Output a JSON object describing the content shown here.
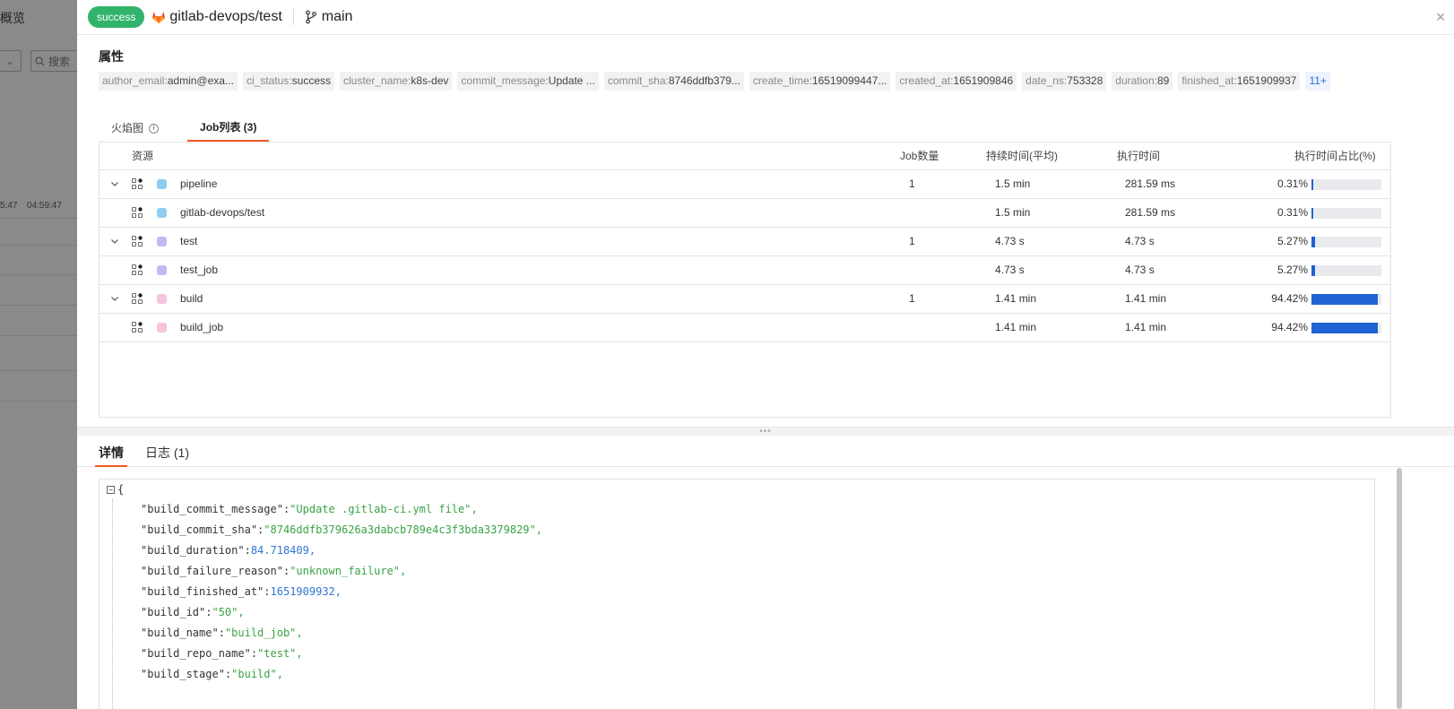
{
  "background": {
    "title": "概览",
    "search_placeholder": "搜索",
    "times": [
      "5:47",
      "04:59:47"
    ]
  },
  "header": {
    "status": "success",
    "repo": "gitlab-devops/test",
    "branch": "main",
    "close_label": "×"
  },
  "properties": {
    "title": "属性",
    "tags": [
      {
        "k": "author_email:",
        "v": "admin@exa..."
      },
      {
        "k": "ci_status:",
        "v": "success"
      },
      {
        "k": "cluster_name:",
        "v": "k8s-dev"
      },
      {
        "k": "commit_message:",
        "v": "Update ..."
      },
      {
        "k": "commit_sha:",
        "v": "8746ddfb379..."
      },
      {
        "k": "create_time:",
        "v": "16519099447..."
      },
      {
        "k": "created_at:",
        "v": "1651909846"
      },
      {
        "k": "date_ns:",
        "v": "753328"
      },
      {
        "k": "duration:",
        "v": "89"
      },
      {
        "k": "finished_at:",
        "v": "1651909937"
      }
    ],
    "more": "11+"
  },
  "tabs": {
    "flame": "火焰图",
    "joblist": "Job列表 (3)"
  },
  "table": {
    "headers": {
      "resource": "资源",
      "job_count": "Job数量",
      "duration_avg": "持续时间(平均)",
      "exec_time": "执行时间",
      "exec_ratio": "执行时间占比(%)"
    },
    "rows": [
      {
        "name": "pipeline",
        "job_count": "1",
        "duration": "1.5 min",
        "exec": "281.59 ms",
        "ratio": "0.31%",
        "ratio_value": 0.31,
        "color": "#8ecdf3",
        "expandable": true
      },
      {
        "name": "gitlab-devops/test",
        "job_count": "",
        "duration": "1.5 min",
        "exec": "281.59 ms",
        "ratio": "0.31%",
        "ratio_value": 0.31,
        "color": "#8ecdf3",
        "expandable": false
      },
      {
        "name": "test",
        "job_count": "1",
        "duration": "4.73 s",
        "exec": "4.73 s",
        "ratio": "5.27%",
        "ratio_value": 5.27,
        "color": "#c6b8f2",
        "expandable": true
      },
      {
        "name": "test_job",
        "job_count": "",
        "duration": "4.73 s",
        "exec": "4.73 s",
        "ratio": "5.27%",
        "ratio_value": 5.27,
        "color": "#c6b8f2",
        "expandable": false
      },
      {
        "name": "build",
        "job_count": "1",
        "duration": "1.41 min",
        "exec": "1.41 min",
        "ratio": "94.42%",
        "ratio_value": 94.42,
        "color": "#f7c3dd",
        "expandable": true
      },
      {
        "name": "build_job",
        "job_count": "",
        "duration": "1.41 min",
        "exec": "1.41 min",
        "ratio": "94.42%",
        "ratio_value": 94.42,
        "color": "#f7c3dd",
        "expandable": false
      }
    ]
  },
  "bottom_tabs": {
    "details": "详情",
    "logs": "日志 (1)"
  },
  "json": {
    "open": "{",
    "lines": [
      {
        "key": "\"build_commit_message\"",
        "value": "\"Update .gitlab-ci.yml file\"",
        "type": "string"
      },
      {
        "key": "\"build_commit_sha\"",
        "value": "\"8746ddfb379626a3dabcb789e4c3f3bda3379829\"",
        "type": "string"
      },
      {
        "key": "\"build_duration\"",
        "value": "84.718409",
        "type": "number"
      },
      {
        "key": "\"build_failure_reason\"",
        "value": "\"unknown_failure\"",
        "type": "string"
      },
      {
        "key": "\"build_finished_at\"",
        "value": "1651909932",
        "type": "number"
      },
      {
        "key": "\"build_id\"",
        "value": "\"50\"",
        "type": "string"
      },
      {
        "key": "\"build_name\"",
        "value": "\"build_job\"",
        "type": "string"
      },
      {
        "key": "\"build_repo_name\"",
        "value": "\"test\"",
        "type": "string"
      },
      {
        "key": "\"build_stage\"",
        "value": "\"build\"",
        "type": "string"
      }
    ]
  },
  "colors": {
    "success": "#32b36c",
    "accent": "#f05b22",
    "bar": "#2063d4",
    "link": "#2f6bdb"
  }
}
